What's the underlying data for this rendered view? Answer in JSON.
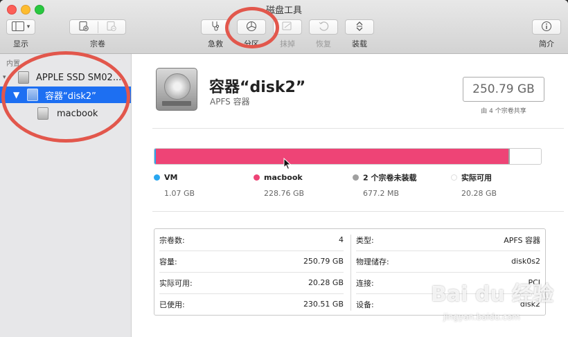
{
  "window": {
    "title": "磁盘工具"
  },
  "toolbar": {
    "view_label": "显示",
    "volume_label": "宗卷",
    "first_aid_label": "急救",
    "partition_label": "分区",
    "erase_label": "抹掉",
    "restore_label": "恢复",
    "mount_label": "装载",
    "info_label": "简介"
  },
  "sidebar": {
    "section": "内置",
    "items": [
      {
        "label": "APPLE SSD SM02..."
      },
      {
        "label": "容器“disk2”"
      },
      {
        "label": "macbook"
      }
    ]
  },
  "volume": {
    "name": "容器“disk2”",
    "type": "APFS 容器",
    "capacity": "250.79 GB",
    "shared_by": "由 4 个宗卷共享"
  },
  "usage": {
    "segments": [
      {
        "name": "VM",
        "value": "1.07 GB",
        "color": "#29a7f0",
        "fraction": 0.0043
      },
      {
        "name": "macbook",
        "value": "228.76 GB",
        "color": "#ee4476",
        "fraction": 0.912
      },
      {
        "name": "2 个宗卷未装载",
        "value": "677.2 MB",
        "color": "#a0a0a0",
        "fraction": 0.0027
      },
      {
        "name": "实际可用",
        "value": "20.28 GB",
        "color": "#ffffff",
        "fraction": 0.081
      }
    ]
  },
  "info": {
    "left": [
      {
        "key": "宗卷数:",
        "value": "4"
      },
      {
        "key": "容量:",
        "value": "250.79 GB"
      },
      {
        "key": "实际可用:",
        "value": "20.28 GB"
      },
      {
        "key": "已使用:",
        "value": "230.51 GB"
      }
    ],
    "right": [
      {
        "key": "类型:",
        "value": "APFS 容器"
      },
      {
        "key": "物理储存:",
        "value": "disk0s2"
      },
      {
        "key": "连接:",
        "value": "PCI"
      },
      {
        "key": "设备:",
        "value": "disk2"
      }
    ]
  },
  "watermark": {
    "brand": "Bai du 经验",
    "url": "jingyan.baidu.com"
  }
}
